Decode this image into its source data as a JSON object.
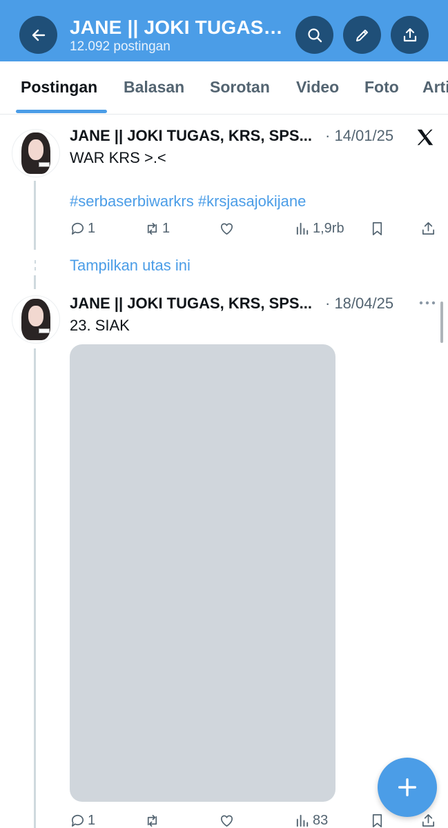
{
  "header": {
    "title": "JANE || JOKI TUGAS, KRS, SPS, dll",
    "post_count": "12.092 postingan",
    "back_icon": "arrow-left-icon",
    "search_icon": "search-icon",
    "edit_icon": "pencil-icon",
    "share_icon": "share-icon",
    "background_color": "#4b9de7"
  },
  "tabs": [
    {
      "label": "Postingan",
      "active": true
    },
    {
      "label": "Balasan"
    },
    {
      "label": "Sorotan"
    },
    {
      "label": "Video"
    },
    {
      "label": "Foto"
    },
    {
      "label": "Artikel"
    }
  ],
  "posts": [
    {
      "author": "JANE || JOKI TUGAS, KRS, SPS...",
      "date": "· 14/01/25",
      "text": "WAR KRS >.<",
      "hashtags": "#serbaserbiwarkrs #krsjasajokijane",
      "badge_icon": "x-logo-icon",
      "replies": "1",
      "retweets": "1",
      "likes": "",
      "views": "1,9rb"
    },
    {
      "author": "JANE || JOKI TUGAS, KRS, SPS...",
      "date": "· 18/04/25",
      "text": "23. SIAK",
      "more_icon": "more-horizontal-icon",
      "replies": "1",
      "retweets": "",
      "likes": "",
      "views": "83"
    }
  ],
  "show_thread": "Tampilkan utas ini",
  "fab_icon": "plus-icon",
  "accent_color": "#4b9de7"
}
